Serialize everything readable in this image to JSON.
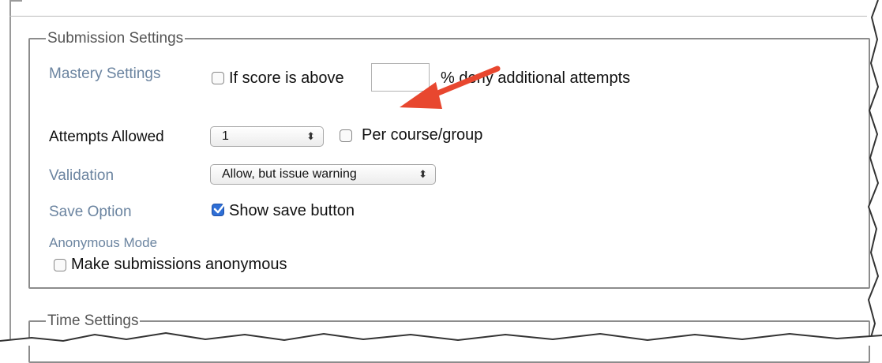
{
  "submission_settings": {
    "legend": "Submission Settings",
    "mastery": {
      "label": "Mastery Settings",
      "checkbox_label": "If score is above",
      "checked": false,
      "score_value": "",
      "suffix": "% deny additional attempts"
    },
    "attempts": {
      "label": "Attempts Allowed",
      "selected": "1",
      "per_course_label": "Per course/group",
      "per_course_checked": false
    },
    "validation": {
      "label": "Validation",
      "selected": "Allow, but issue warning"
    },
    "save_option": {
      "label": "Save Option",
      "checkbox_label": "Show save button",
      "checked": true
    },
    "anonymous": {
      "label": "Anonymous Mode",
      "checkbox_label": "Make submissions anonymous",
      "checked": false
    }
  },
  "time_settings": {
    "legend": "Time Settings"
  },
  "annotation": {
    "arrow_color": "#e8472f"
  },
  "colors": {
    "label_grey": "#6b84a0",
    "checkbox_checked": "#2f6fd6"
  }
}
